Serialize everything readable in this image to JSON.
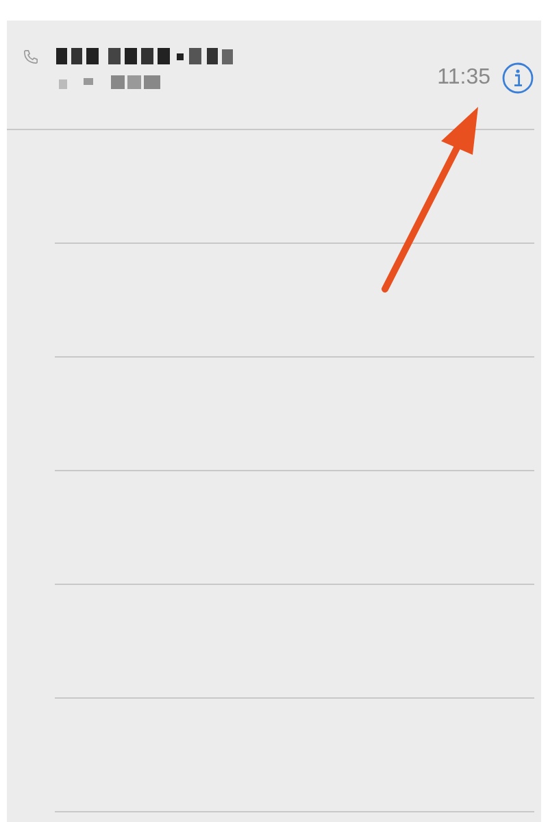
{
  "recents": [
    {
      "time": "11:35"
    }
  ]
}
